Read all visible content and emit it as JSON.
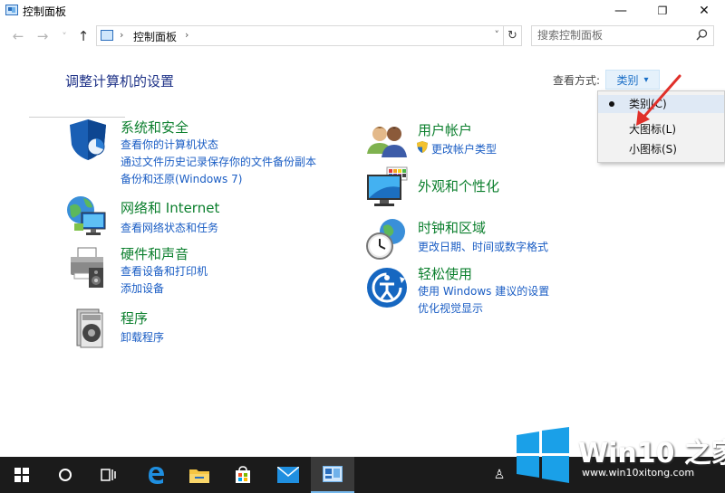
{
  "window": {
    "title": "控制面板",
    "minimize_glyph": "—",
    "maximize_glyph": "❐",
    "close_glyph": "✕"
  },
  "nav": {
    "back_glyph": "←",
    "forward_glyph": "→",
    "history_glyph": "˅",
    "up_glyph": "↑",
    "breadcrumb_sep": "›",
    "breadcrumb": "控制面板",
    "dropdown_glyph": "˅",
    "refresh_glyph": "↻"
  },
  "search": {
    "placeholder": "搜索控制面板",
    "icon": "search-icon"
  },
  "main": {
    "title": "调整计算机的设置",
    "view_by_label": "查看方式:",
    "view_by_value": "类别",
    "view_by_caret": "▾"
  },
  "categories_left": [
    {
      "title": "系统和安全",
      "icon": "shield-icon",
      "links": [
        "查看你的计算机状态",
        "通过文件历史记录保存你的文件备份副本",
        "备份和还原(Windows 7)"
      ]
    },
    {
      "title": "网络和 Internet",
      "icon": "network-globe-icon",
      "links": [
        "查看网络状态和任务"
      ]
    },
    {
      "title": "硬件和声音",
      "icon": "printer-icon",
      "links": [
        "查看设备和打印机",
        "添加设备"
      ]
    },
    {
      "title": "程序",
      "icon": "programs-icon",
      "links": [
        "卸载程序"
      ]
    }
  ],
  "categories_right": [
    {
      "title": "用户帐户",
      "icon": "users-icon",
      "links": [
        "更改帐户类型"
      ]
    },
    {
      "title": "外观和个性化",
      "icon": "monitor-palette-icon",
      "links": []
    },
    {
      "title": "时钟和区域",
      "icon": "clock-globe-icon",
      "links": [
        "更改日期、时间或数字格式"
      ]
    },
    {
      "title": "轻松使用",
      "icon": "ease-of-access-icon",
      "links": [
        "使用 Windows 建议的设置",
        "优化视觉显示"
      ]
    }
  ],
  "view_menu": {
    "items": [
      "类别(C)",
      "大图标(L)",
      "小图标(S)"
    ],
    "selected": "类别(C)"
  },
  "taskbar": {
    "items": [
      "start-icon",
      "cortana-icon",
      "task-view-icon",
      "edge-icon",
      "file-explorer-icon",
      "store-icon",
      "mail-icon",
      "control-panel-icon"
    ],
    "people_glyph": "♙"
  },
  "watermark": {
    "text": "Win10 之家",
    "url": "www.win10xitong.com"
  },
  "colors": {
    "accent": "#1a6fc7",
    "category_title": "#0b7f2d",
    "link": "#1a5dc4",
    "page_title": "#1e3287",
    "arrow": "#e0302a"
  }
}
